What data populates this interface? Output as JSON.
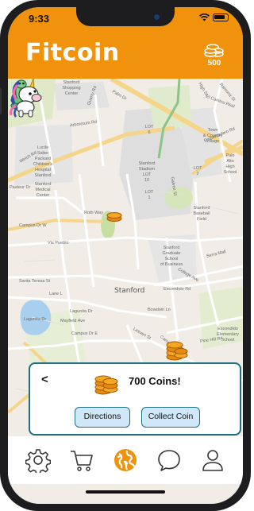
{
  "status_bar": {
    "time": "9:33"
  },
  "header": {
    "title": "Fitcoin",
    "coin_balance": "500"
  },
  "map": {
    "labels": {
      "shopping_center": "Stanford\nShopping\nCenter",
      "lucile": "Lucile\nSalter\nPackard\nChildren's\nHospital\nStanford",
      "medical_center": "Stanford\nMedical\nCenter",
      "stadium": "Stanford\nStadium\nLOT\n10",
      "lot_6": "LOT\n6",
      "lot_1": "LOT\n1",
      "lot_2": "LOT\n2",
      "town_country": "Town\n& Country\nVillage",
      "palo_alto_high": "Palo\nAlto\nHigh\nSchool",
      "baseball_field": "Stanford\nBaseball\nField",
      "graduate_school": "Stanford\nGraduate\nSchool\nof Business",
      "stanford": "Stanford",
      "escondido_school": "Escondido\nElementary\nSchool",
      "lagunita": "Lagunita Dr"
    },
    "streets": {
      "arboretum": "Arboretum Rd",
      "palm": "Palm Dr",
      "embarcadero": "Embarcadero Rd",
      "campus_dr_w": "Campus Dr W",
      "via_pueblo": "Via Pueblo",
      "santa_teresa": "Santa Teresa St",
      "escondido_rd": "Escondido Rd",
      "bowdoin": "Bowdoin Ln",
      "campus_dr_e": "Campus Dr E",
      "roth_way": "Roth Way",
      "quarry": "Quarry Rd",
      "welch": "Welch Rd",
      "pasteur": "Pasteur Dr",
      "mayfield": "Mayfield Ave",
      "lasuen": "Lasuen St",
      "campus_dr_s": "Campus Dr E",
      "el_camino": "El Camino Real",
      "high_st": "High St",
      "ramona": "Ramona St",
      "galvez": "Galvez St",
      "serra": "Serra Mall",
      "pine_hill": "Pine Hill Rd",
      "college": "College Ave",
      "lane_l": "Lane L"
    }
  },
  "coin_card": {
    "back_label": "<",
    "title": "700 Coins!",
    "directions_label": "Directions",
    "collect_label": "Collect Coin"
  },
  "tabbar": {
    "items": [
      {
        "icon": "gear-icon"
      },
      {
        "icon": "cart-icon"
      },
      {
        "icon": "globe-icon",
        "active": true
      },
      {
        "icon": "chat-icon"
      },
      {
        "icon": "user-icon"
      }
    ]
  },
  "colors": {
    "accent": "#f0920c",
    "card_border": "#1f6f83",
    "button_fill": "#cfe7f7",
    "map_bg": "#f1ede6"
  }
}
